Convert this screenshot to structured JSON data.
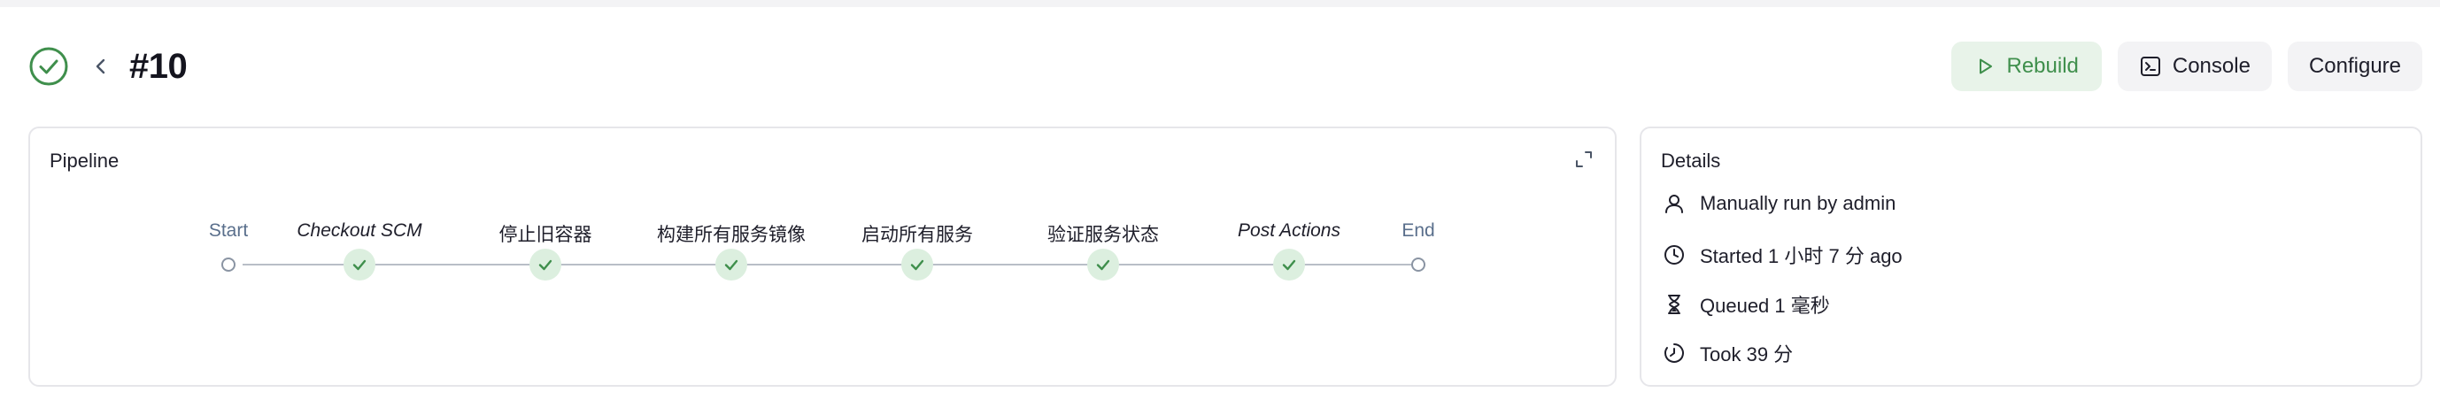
{
  "run": {
    "status": "success",
    "title": "#10"
  },
  "actions": {
    "rebuild": "Rebuild",
    "console": "Console",
    "configure": "Configure"
  },
  "pipeline": {
    "title": "Pipeline",
    "start_label": "Start",
    "end_label": "End",
    "stages": [
      {
        "label": "Checkout SCM",
        "status": "success",
        "italic": true
      },
      {
        "label": "停止旧容器",
        "status": "success",
        "italic": false
      },
      {
        "label": "构建所有服务镜像",
        "status": "success",
        "italic": false
      },
      {
        "label": "启动所有服务",
        "status": "success",
        "italic": false
      },
      {
        "label": "验证服务状态",
        "status": "success",
        "italic": false
      },
      {
        "label": "Post Actions",
        "status": "success",
        "italic": true
      }
    ]
  },
  "details": {
    "title": "Details",
    "items": [
      {
        "icon": "user-icon",
        "text": "Manually run by admin"
      },
      {
        "icon": "clock-icon",
        "text": "Started 1 小时 7 分 ago"
      },
      {
        "icon": "hourglass-icon",
        "text": "Queued 1 毫秒"
      },
      {
        "icon": "timer-icon",
        "text": "Took 39 分"
      }
    ]
  },
  "colors": {
    "success": "#3f8f4c",
    "success_bg": "#dcefdf",
    "connector": "#b9bec7"
  }
}
